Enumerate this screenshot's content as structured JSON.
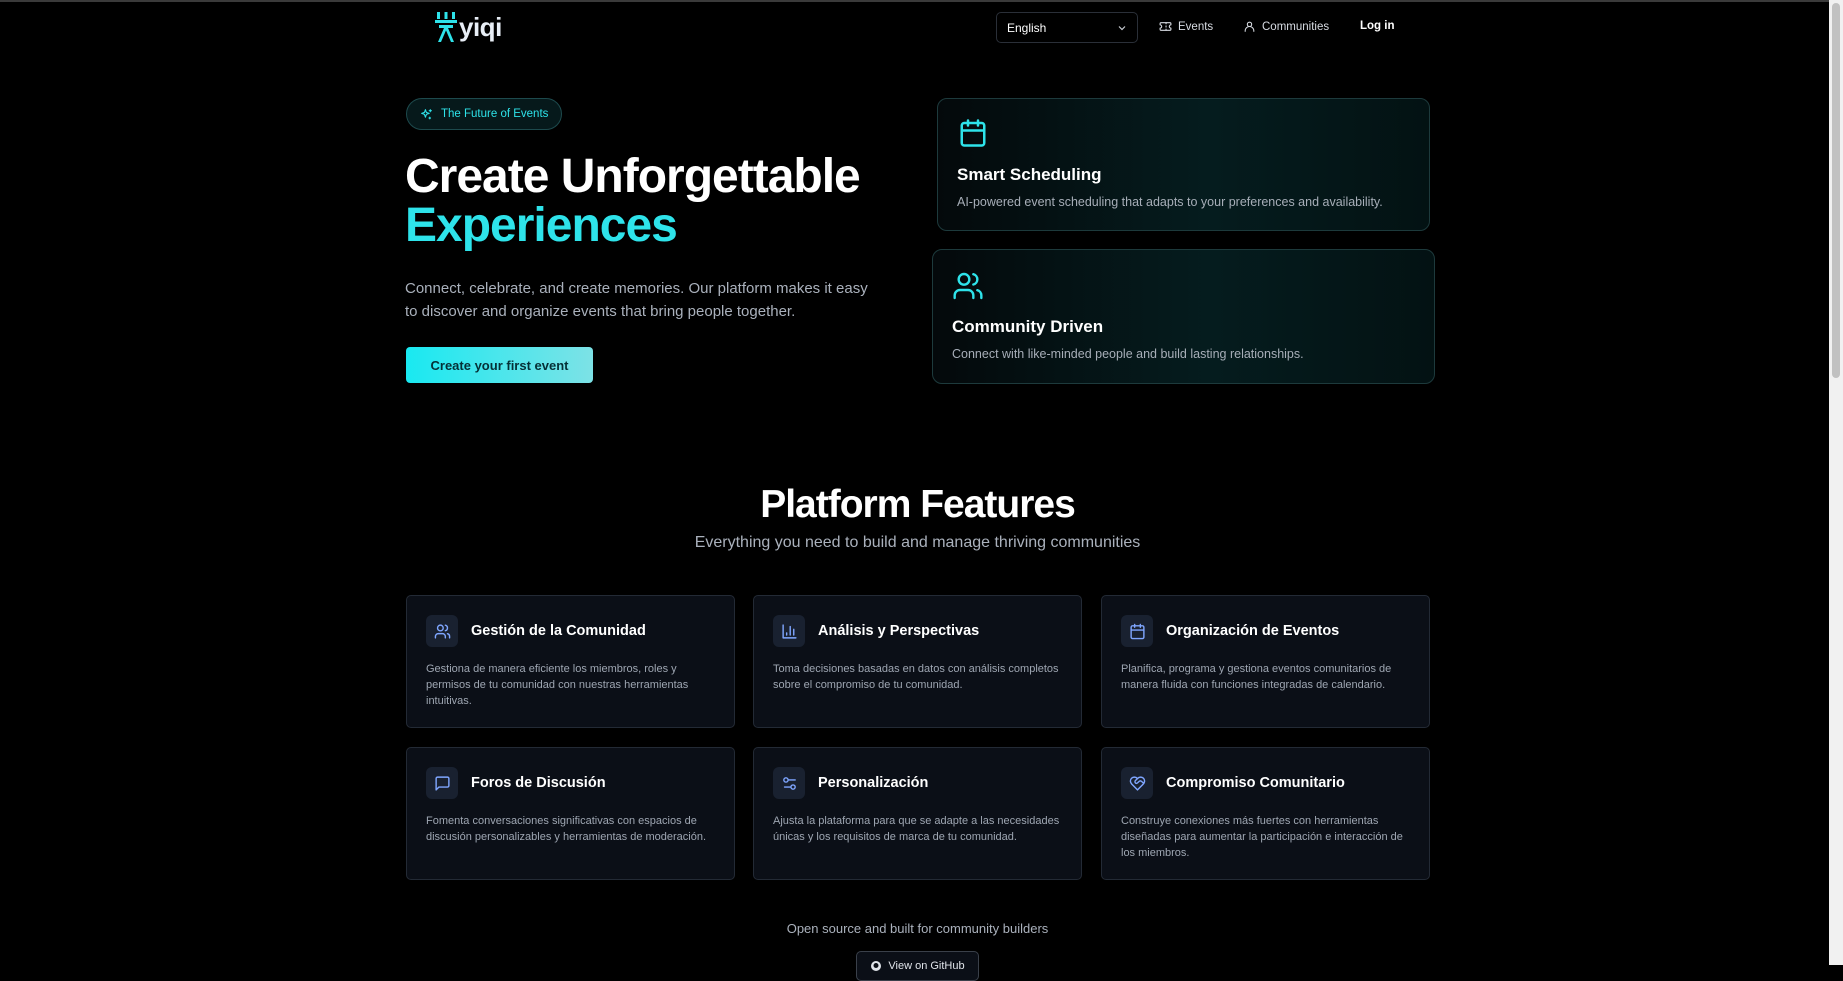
{
  "header": {
    "logo_text": "yiqi",
    "language": "English",
    "nav": {
      "events": "Events",
      "communities": "Communities",
      "login": "Log in"
    }
  },
  "hero": {
    "badge": "The Future of Events",
    "title_line1": "Create Unforgettable",
    "title_line2": "Experiences",
    "subtitle": "Connect, celebrate, and create memories. Our platform makes it easy to discover and organize events that bring people together.",
    "cta": "Create your first event",
    "cards": [
      {
        "icon": "calendar-icon",
        "title": "Smart Scheduling",
        "desc": "AI-powered event scheduling that adapts to your preferences and availability."
      },
      {
        "icon": "users-icon",
        "title": "Community Driven",
        "desc": "Connect with like-minded people and build lasting relationships."
      }
    ]
  },
  "features": {
    "heading": "Platform Features",
    "subheading": "Everything you need to build and manage thriving communities",
    "items": [
      {
        "icon": "users-icon",
        "title": "Gestión de la Comunidad",
        "desc": "Gestiona de manera eficiente los miembros, roles y permisos de tu comunidad con nuestras herramientas intuitivas."
      },
      {
        "icon": "bar-chart-icon",
        "title": "Análisis y Perspectivas",
        "desc": "Toma decisiones basadas en datos con análisis completos sobre el compromiso de tu comunidad."
      },
      {
        "icon": "calendar-icon",
        "title": "Organización de Eventos",
        "desc": "Planifica, programa y gestiona eventos comunitarios de manera fluida con funciones integradas de calendario."
      },
      {
        "icon": "message-square-icon",
        "title": "Foros de Discusión",
        "desc": "Fomenta conversaciones significativas con espacios de discusión personalizables y herramientas de moderación."
      },
      {
        "icon": "sliders-icon",
        "title": "Personalización",
        "desc": "Ajusta la plataforma para que se adapte a las necesidades únicas y los requisitos de marca de tu comunidad."
      },
      {
        "icon": "heart-handshake-icon",
        "title": "Compromiso Comunitario",
        "desc": "Construye conexiones más fuertes con herramientas diseñadas para aumentar la participación e interacción de los miembros."
      }
    ]
  },
  "footer": {
    "text": "Open source and built for community builders",
    "github_button": "View on GitHub"
  },
  "colors": {
    "accent": "#2ee3ea",
    "background": "#000000",
    "card": "#0b0f17"
  }
}
